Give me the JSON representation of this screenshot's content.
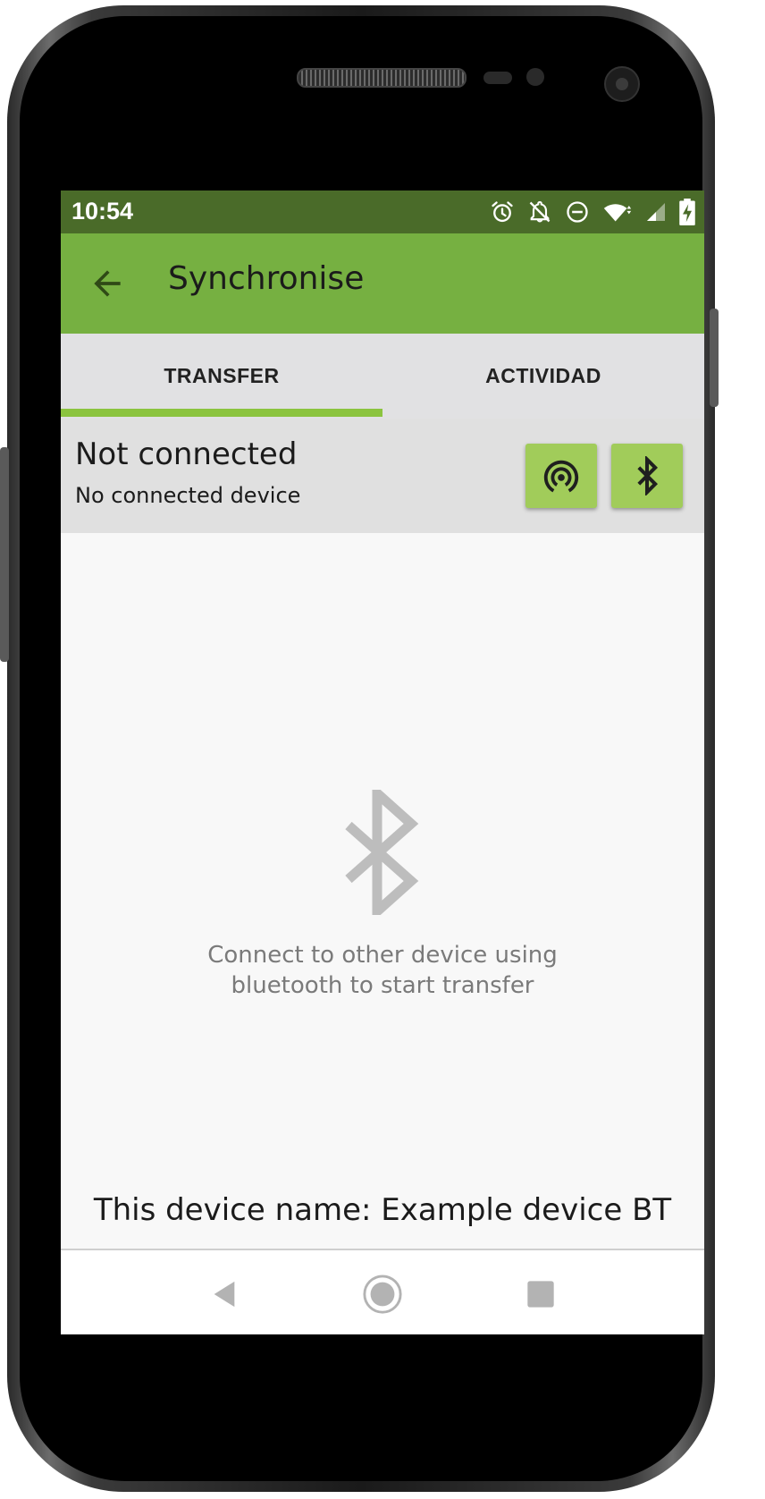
{
  "status_bar": {
    "time": "10:54",
    "icons": [
      "alarm-icon",
      "notifications-off-icon",
      "do-not-disturb-icon",
      "wifi-icon",
      "cell-signal-icon",
      "battery-charging-icon"
    ]
  },
  "app_bar": {
    "title": "Synchronise",
    "back_icon": "arrow-back-icon"
  },
  "tabs": [
    {
      "label": "TRANSFER",
      "selected": true
    },
    {
      "label": "ACTIVIDAD",
      "selected": false
    }
  ],
  "connection": {
    "title": "Not connected",
    "subtitle": "No connected device",
    "buttons": [
      {
        "icon": "hotspot-icon"
      },
      {
        "icon": "bluetooth-icon"
      }
    ]
  },
  "empty_state": {
    "icon": "bluetooth-icon",
    "line1": "Connect to other device using",
    "line2": "bluetooth to start transfer"
  },
  "device_name": "This device name: Example device BT",
  "nav_bar": {
    "buttons": [
      "nav-back-icon",
      "nav-home-icon",
      "nav-recents-icon"
    ]
  },
  "colors": {
    "status_bar": "#4a6b29",
    "app_bar": "#76b041",
    "tab_indicator": "#8bc43f",
    "action_button": "#a1cc5a"
  }
}
